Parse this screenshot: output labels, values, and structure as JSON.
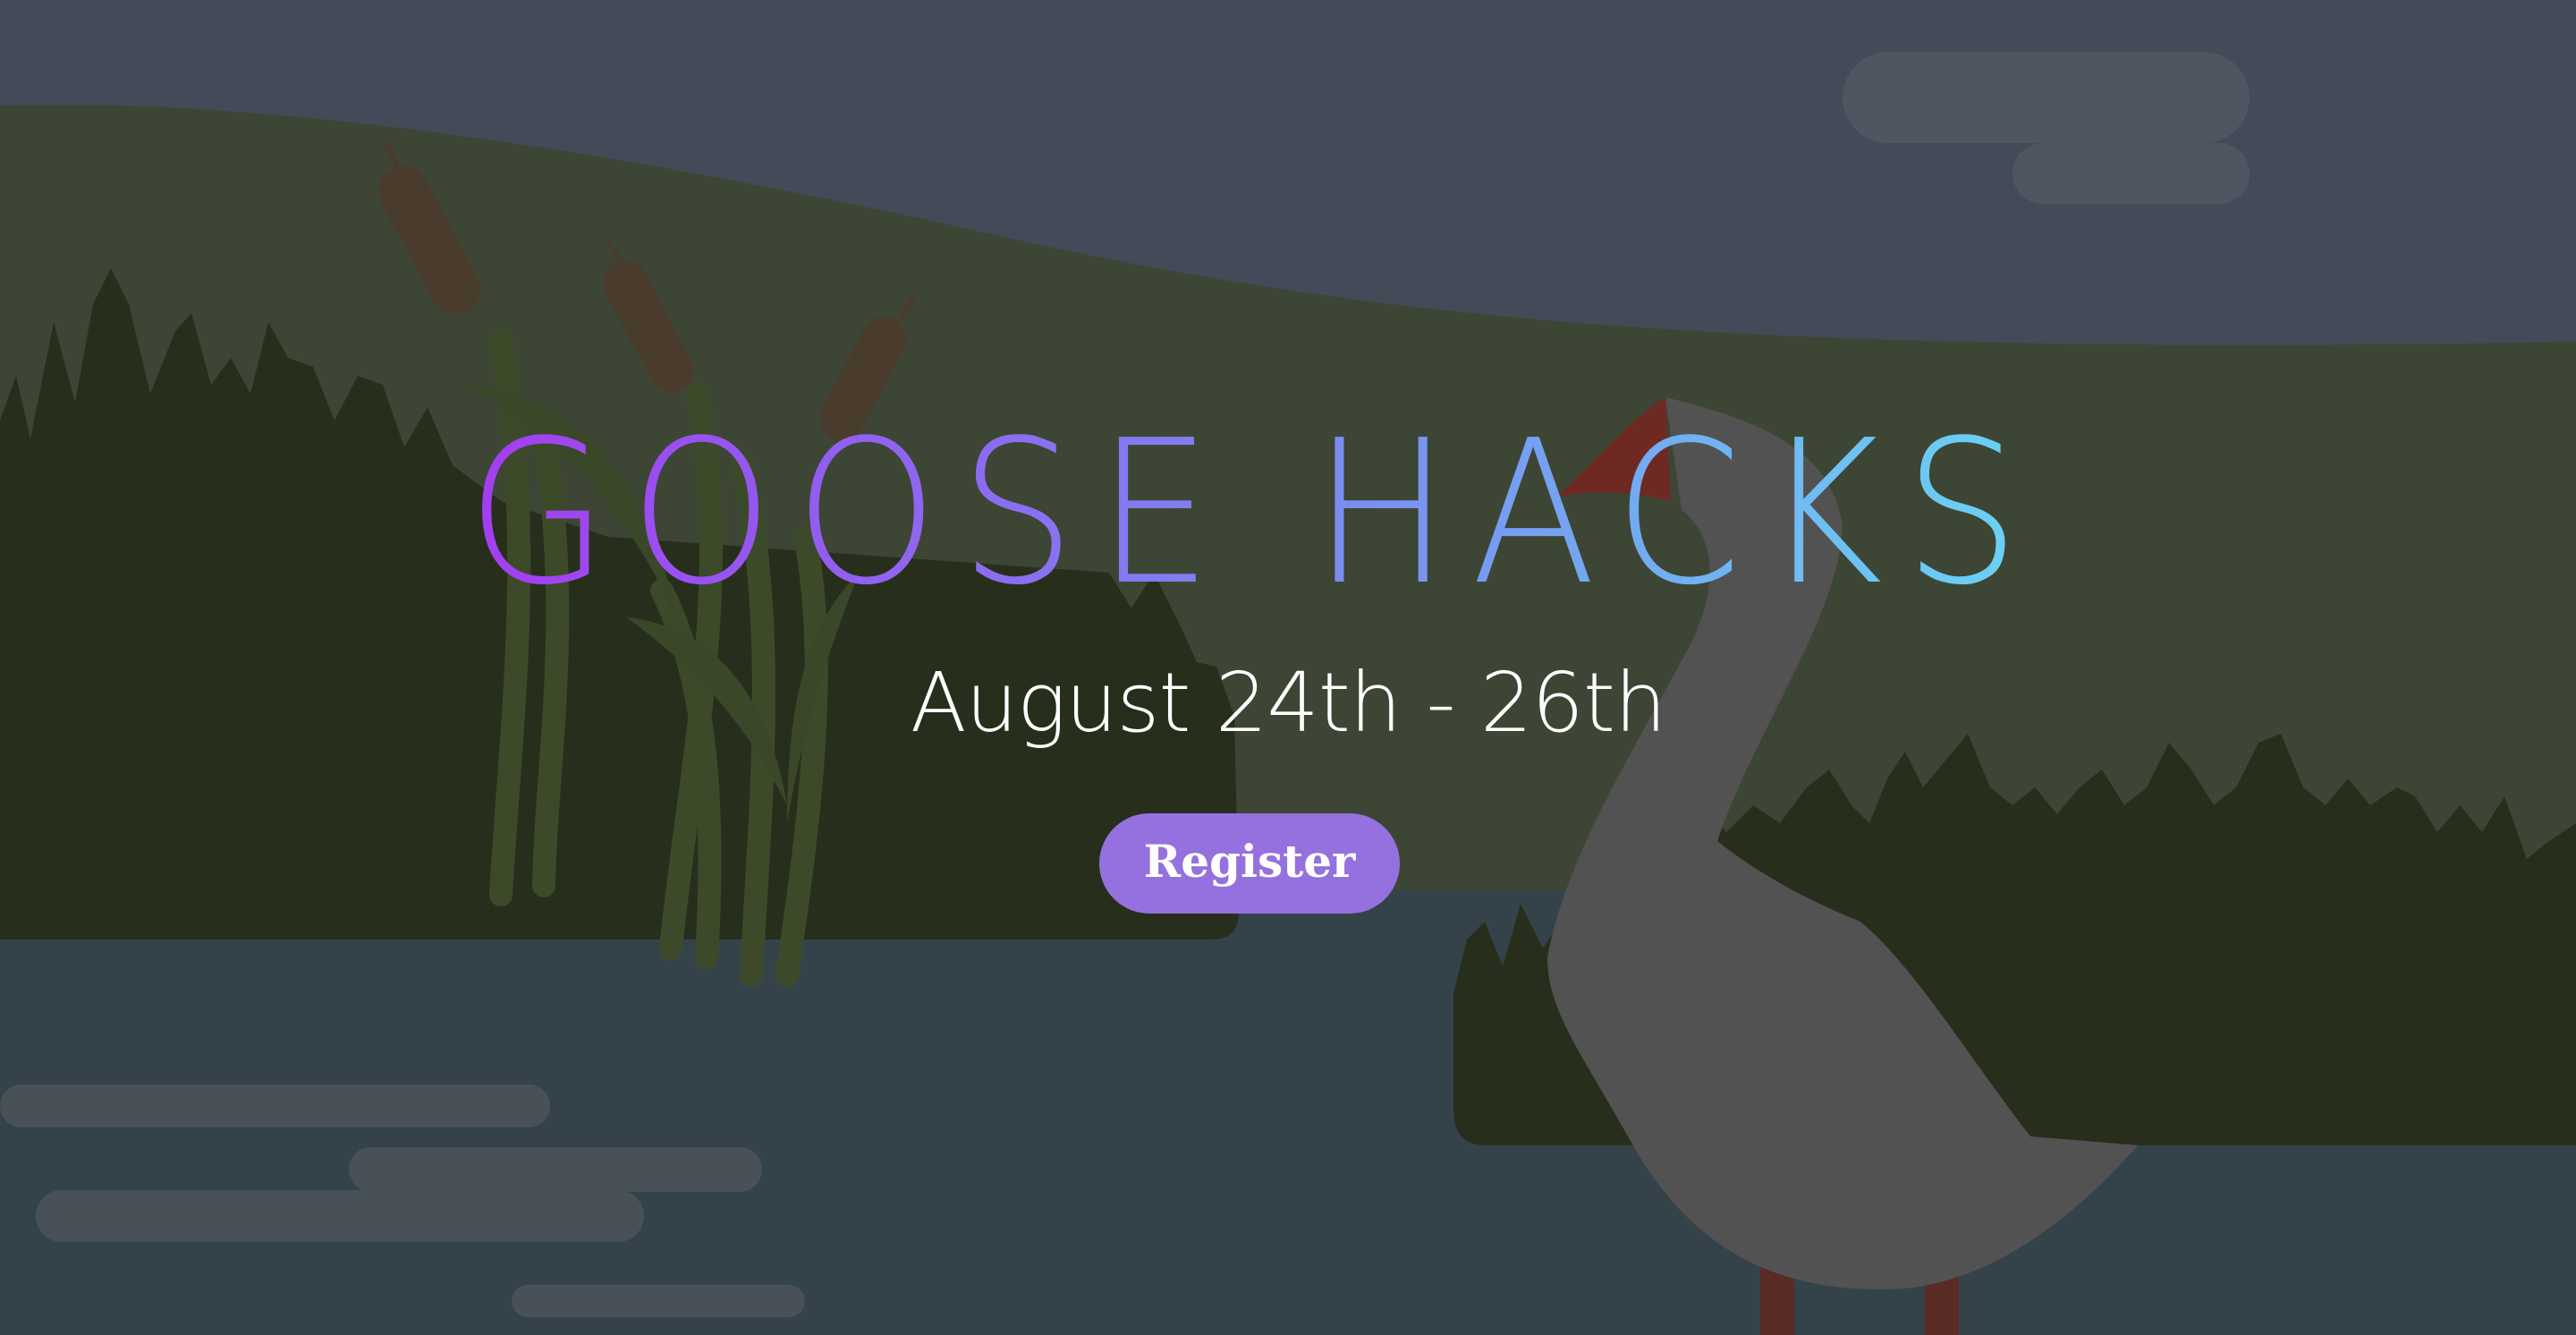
{
  "hero": {
    "title": "GOOSE HACKS",
    "date": "August 24th - 26th",
    "register_label": "Register",
    "title_gradient": [
      "#a43df0",
      "#7a8cf0",
      "#6ad4f4"
    ],
    "button_color": "#9471de"
  },
  "background": {
    "illustration": "pond-scene-with-goose",
    "sky_color": "#424b57",
    "hill_color": "#3d4534",
    "grass_color": "#272f1c",
    "water_color": "#34434a",
    "goose_color": "#525252"
  }
}
